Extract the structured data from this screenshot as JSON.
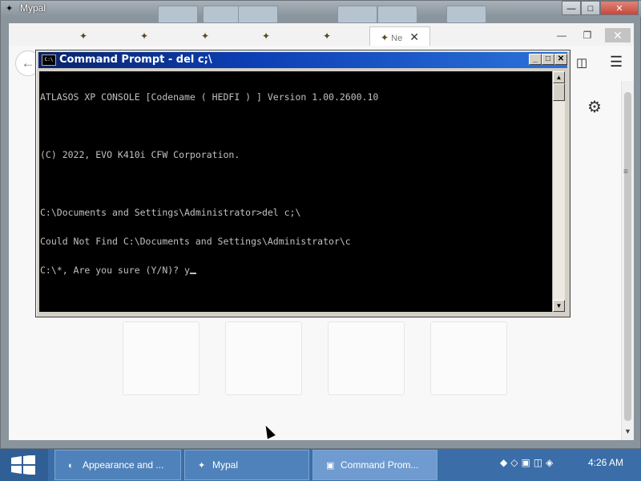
{
  "mypal_window": {
    "title": "Mypal",
    "controls": {
      "minimize": "—",
      "maximize": "□",
      "close": "✕"
    }
  },
  "browser": {
    "tabs": [
      {
        "icon": "mypal-icon",
        "label": ""
      },
      {
        "icon": "mypal-icon",
        "label": ""
      },
      {
        "icon": "mypal-icon",
        "label": ""
      },
      {
        "icon": "mypal-icon",
        "label": ""
      },
      {
        "icon": "mypal-icon",
        "label": ""
      }
    ],
    "active_tab": {
      "label": "Ne",
      "close": "✕"
    },
    "controls": {
      "minimize": "—",
      "restore": "❐",
      "close": "✕"
    },
    "nav": {
      "back": "←",
      "sidebar": "◫",
      "menu": "☰"
    },
    "settings_icon": "⚙",
    "scroll_grip": "≡",
    "scroll_down": "▼"
  },
  "cmd": {
    "title": "Command Prompt - del c;\\",
    "icon_text": "C:\\",
    "controls": {
      "minimize": "_",
      "maximize": "□",
      "close": "✕"
    },
    "lines": [
      "ATLASOS XP CONSOLE [Codename ( HEDFI ) ] Version 1.00.2600.10",
      "",
      "(C) 2022, EVO K410i CFW Corporation.",
      "",
      "C:\\Documents and Settings\\Administrator>del c;\\",
      "Could Not Find C:\\Documents and Settings\\Administrator\\c",
      "C:\\*, Are you sure (Y/N)? y"
    ],
    "scroll_up": "▲",
    "scroll_down": "▼"
  },
  "taskbar": {
    "items": [
      {
        "icon": "appearance-icon",
        "icon_glyph": "◐",
        "label": "Appearance and ..."
      },
      {
        "icon": "mypal-icon",
        "icon_glyph": "✦",
        "label": "Mypal"
      },
      {
        "icon": "cmd-icon",
        "icon_glyph": "▣",
        "label": "Command Prom..."
      }
    ],
    "tray": "◆◇▣◫◈",
    "clock": "4:26 AM"
  },
  "colors": {
    "taskbar": "#3b6ea8",
    "cmd_titlebar": "#0a246a",
    "console_bg": "#000000",
    "console_fg": "#c0c0c0"
  }
}
